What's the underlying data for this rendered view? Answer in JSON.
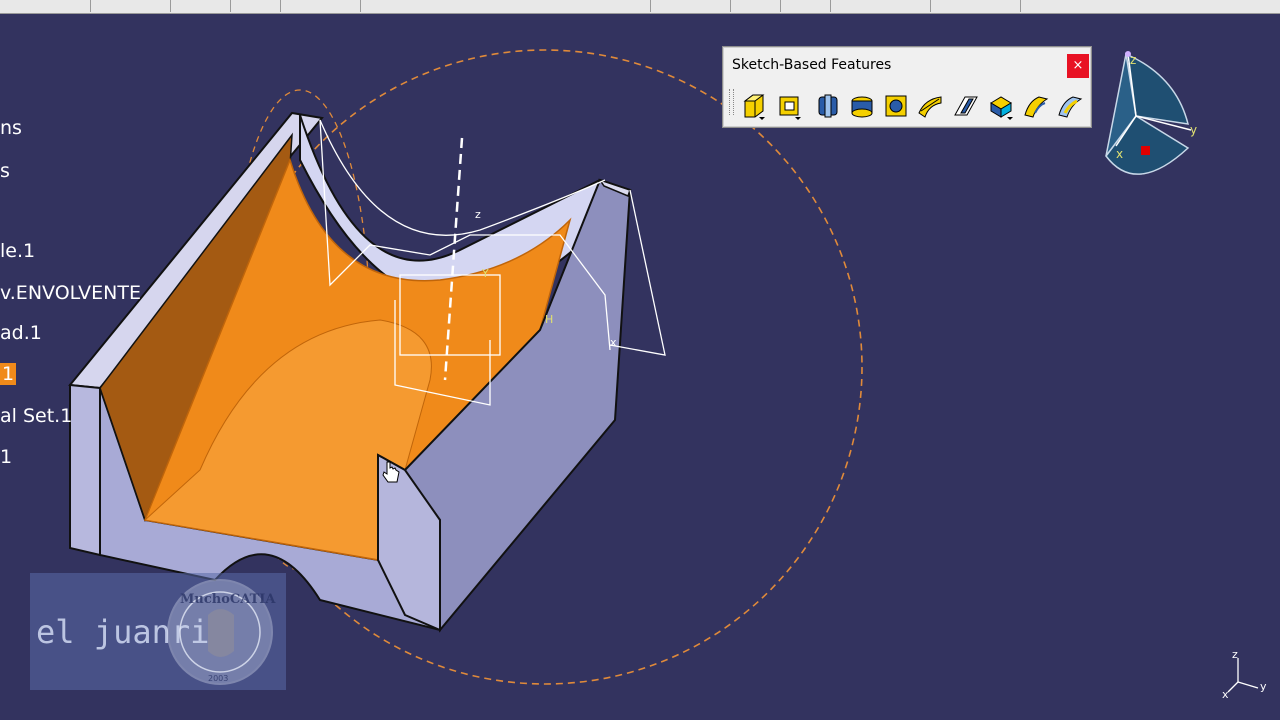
{
  "tree": {
    "items": [
      {
        "label": "ns",
        "selected": false
      },
      {
        "label": "s",
        "selected": false
      },
      {
        "label": "le.1",
        "selected": false
      },
      {
        "label": "v.ENVOLVENTE",
        "selected": false
      },
      {
        "label": "ad.1",
        "selected": false
      },
      {
        "label": "1",
        "selected": true
      },
      {
        "label": "al Set.1",
        "selected": false
      },
      {
        "label": "1",
        "selected": false
      }
    ]
  },
  "panel": {
    "title": "Sketch-Based Features",
    "close_label": "×",
    "tools": [
      {
        "name": "pad-tool",
        "icon": "pad-icon"
      },
      {
        "name": "pocket-tool",
        "icon": "pocket-icon"
      },
      {
        "name": "shaft-tool",
        "icon": "shaft-icon"
      },
      {
        "name": "groove-tool",
        "icon": "groove-icon"
      },
      {
        "name": "hole-tool",
        "icon": "hole-icon"
      },
      {
        "name": "rib-tool",
        "icon": "rib-icon"
      },
      {
        "name": "slot-tool",
        "icon": "slot-icon"
      },
      {
        "name": "stiffener-tool",
        "icon": "stiffener-icon"
      },
      {
        "name": "multi-sections-solid-tool",
        "icon": "multi-sections-icon"
      },
      {
        "name": "removed-multi-sections-tool",
        "icon": "removed-multi-sections-icon"
      }
    ]
  },
  "compass": {
    "x_label": "x",
    "y_label": "y",
    "z_label": "z"
  },
  "mini_axis": {
    "x_label": "x",
    "y_label": "y",
    "z_label": "z"
  },
  "watermark": {
    "text": "el juanri",
    "badge_text": "MuchoCATIA",
    "year": "2003"
  },
  "colors": {
    "background": "#33335f",
    "selection": "#f08a1a",
    "part_face": "#a8aad6",
    "part_dark": "#7c7ca6",
    "pocket": "#f08a1a"
  }
}
